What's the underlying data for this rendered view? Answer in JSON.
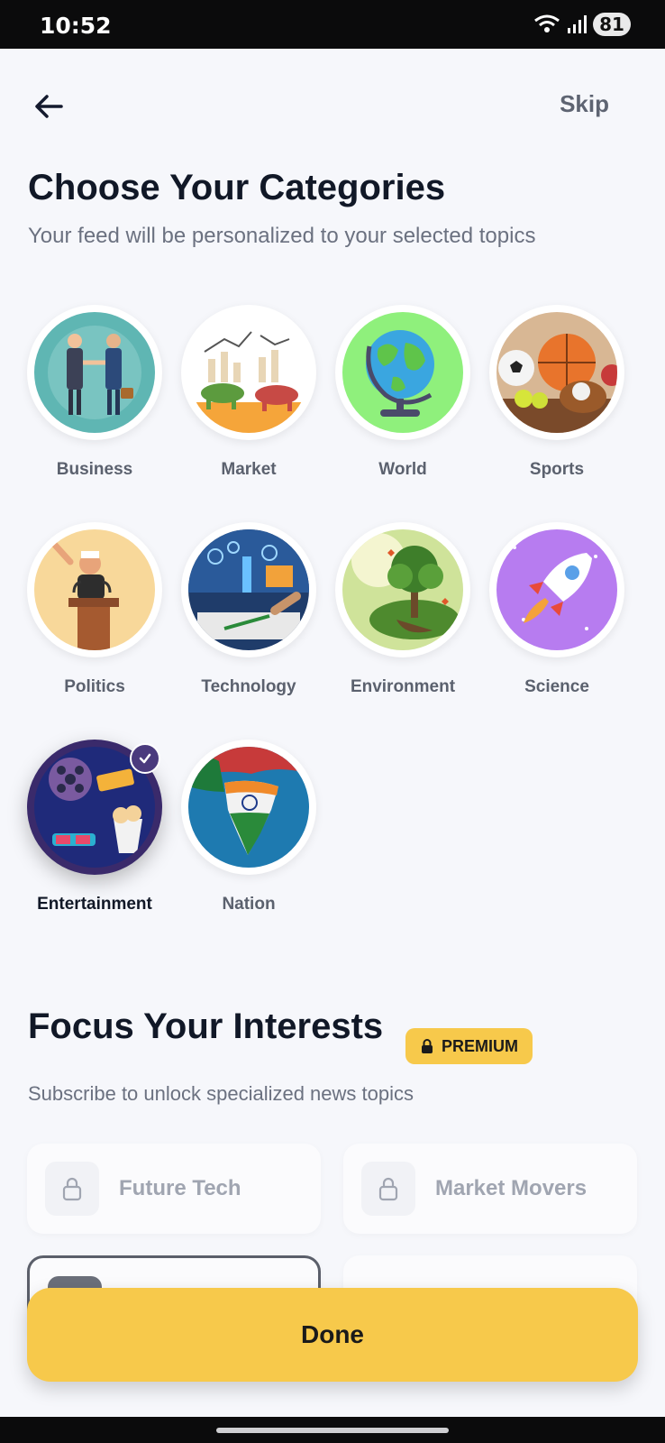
{
  "status": {
    "time": "10:52",
    "battery": "81"
  },
  "header": {
    "skip_label": "Skip"
  },
  "categories_section": {
    "title": "Choose Your Categories",
    "subtitle": "Your feed will be personalized to your selected topics",
    "items": [
      {
        "label": "Business",
        "selected": false
      },
      {
        "label": "Market",
        "selected": false
      },
      {
        "label": "World",
        "selected": false
      },
      {
        "label": "Sports",
        "selected": false
      },
      {
        "label": "Politics",
        "selected": false
      },
      {
        "label": "Technology",
        "selected": false
      },
      {
        "label": "Environment",
        "selected": false
      },
      {
        "label": "Science",
        "selected": false
      },
      {
        "label": "Entertainment",
        "selected": true
      },
      {
        "label": "Nation",
        "selected": false
      }
    ]
  },
  "interests_section": {
    "title": "Focus Your Interests",
    "badge": "PREMIUM",
    "subtitle": "Subscribe to unlock specialized news topics",
    "cards": [
      {
        "label": "Future Tech",
        "locked": true
      },
      {
        "label": "Market Movers",
        "locked": true
      }
    ]
  },
  "done_label": "Done",
  "colors": {
    "accent": "#f7c94b",
    "selected_ring": "#3a2a6b",
    "background": "#f6f7fb"
  }
}
